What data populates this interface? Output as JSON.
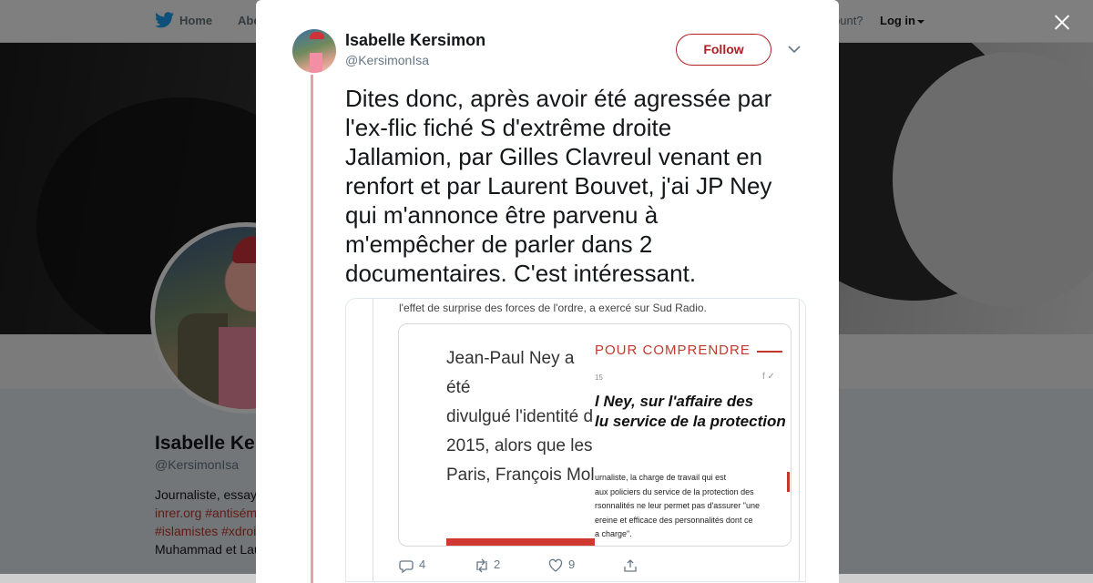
{
  "background_page": {
    "nav": {
      "home_label": "Home",
      "about_label": "Abo",
      "account_prompt": "ccount?",
      "login_label": "Log in"
    },
    "profile": {
      "name": "Isabelle Ke",
      "handle": "@KersimonIsa",
      "bio_line1": "Journaliste, essay",
      "bio_line2": "inrer.org #antisém",
      "bio_line3": "#islamistes #xdroi",
      "bio_line4": "Muhammad et Lau"
    }
  },
  "modal": {
    "author": {
      "name": "Isabelle Kersimon",
      "handle": "@KersimonIsa"
    },
    "follow_label": "Follow",
    "tweet_text": "Dites donc, après avoir été agressée par\nl'ex-flic fiché S d'extrême droite\nJallamion, par Gilles Clavreul venant en\nrenfort et par Laurent Bouvet, j'ai JP Ney\nqui m'annonce être parvenu à\nm'empêcher de parler dans 2\ndocumentaires. C'est intéressant.",
    "embedded_image": {
      "caption": "l'effet de surprise des forces de l'ordre, a exercé sur Sud Radio.",
      "left_text": "Jean-Paul Ney a été\ndivulgué l'identité d\n2015, alors que les\nParis, François Mol\nsurprise\" dans la tra",
      "right_header": "POUR COMPRENDRE",
      "right_small": "15",
      "right_social": "f ✓",
      "right_title": "l Ney, sur l'affaire des\nlu service de la protection",
      "right_body": "urnaliste, la charge de travail qui est\naux policiers du service de la protection des\nrsonnalités ne leur permet pas d'assurer \"une\nereine et efficace des personnalités dont ce\na charge\".",
      "actions": {
        "replies": "4",
        "retweets": "2",
        "likes": "9"
      }
    }
  },
  "colors": {
    "accent": "#b11e22",
    "thread_line": "#e2a3a3",
    "overlay": "rgba(0,0,0,0.5)"
  }
}
